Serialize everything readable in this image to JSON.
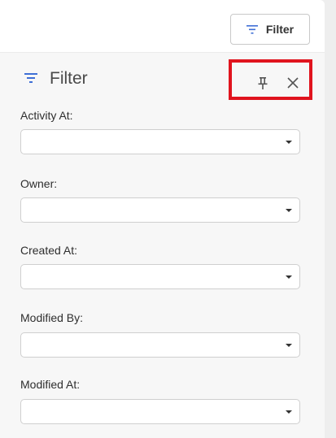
{
  "toolbar": {
    "filter_button_label": "Filter",
    "filter_icon": "filter-lines-icon"
  },
  "panel": {
    "title": "Filter",
    "title_icon": "filter-lines-icon",
    "pin_icon": "pin-icon",
    "close_icon": "close-icon",
    "highlight_color": "#e0141e",
    "accent_color": "#3f6fd6"
  },
  "fields": [
    {
      "label": "Activity At:",
      "value": ""
    },
    {
      "label": "Owner:",
      "value": ""
    },
    {
      "label": "Created At:",
      "value": ""
    },
    {
      "label": "Modified By:",
      "value": ""
    },
    {
      "label": "Modified At:",
      "value": ""
    }
  ]
}
